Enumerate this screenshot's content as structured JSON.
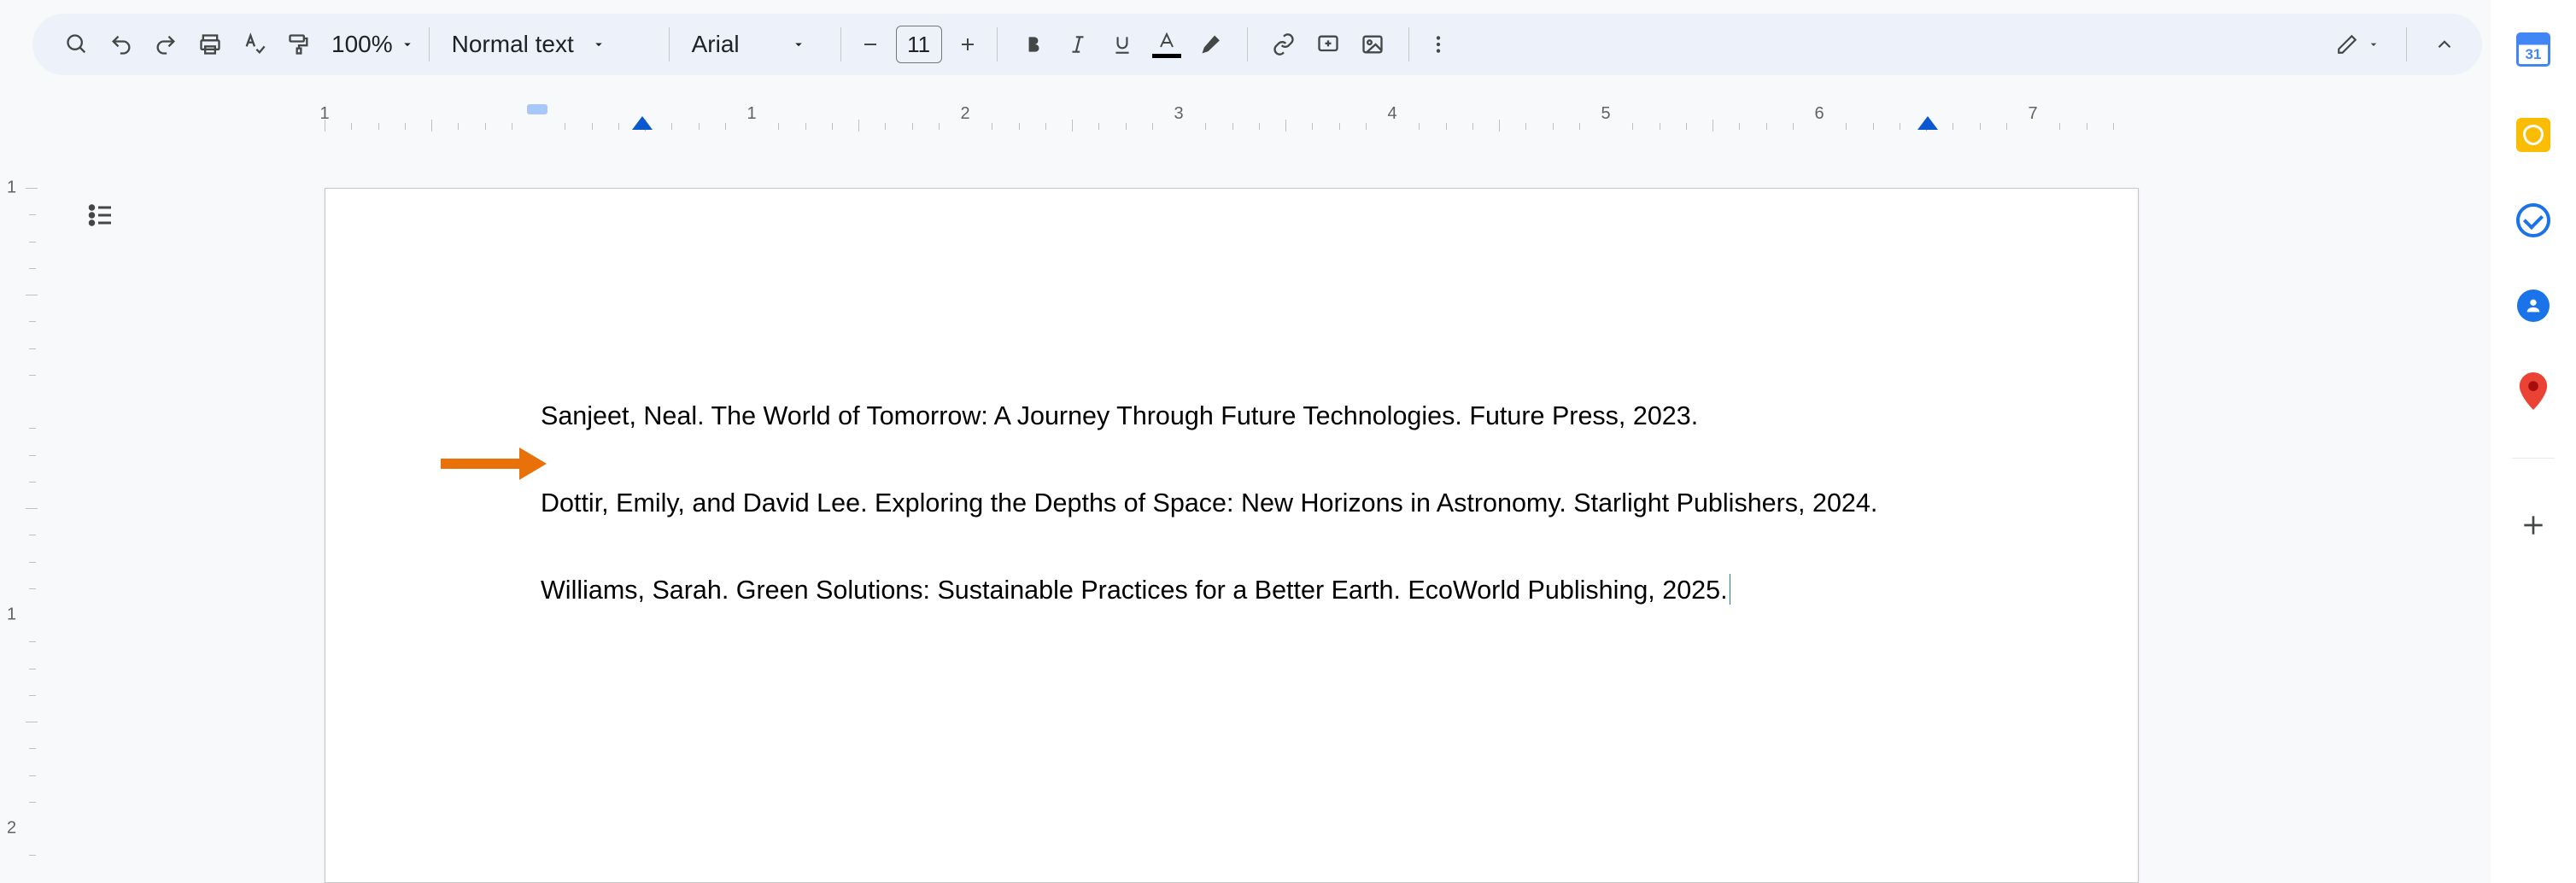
{
  "toolbar": {
    "zoom": "100%",
    "style": "Normal text",
    "font": "Arial",
    "font_size": "11"
  },
  "ruler": {
    "h_numbers": [
      "1",
      "1",
      "2",
      "3",
      "4",
      "5",
      "6",
      "7"
    ],
    "v_numbers": [
      "1",
      "1",
      "2"
    ]
  },
  "sidebar": {
    "calendar_day": "31"
  },
  "document": {
    "entries": [
      "Sanjeet, Neal. The World of Tomorrow: A Journey Through Future Technologies. Future Press, 2023.",
      "Dottir, Emily, and David Lee. Exploring the Depths of Space: New Horizons in Astronomy. Starlight Publishers, 2024.",
      "Williams, Sarah. Green Solutions: Sustainable Practices for a Better Earth. EcoWorld Publishing, 2025."
    ]
  }
}
